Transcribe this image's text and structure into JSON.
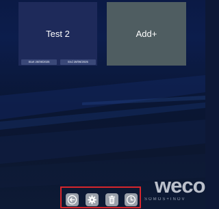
{
  "cards": {
    "test": {
      "title": "Test 2",
      "start_label": "Start 25/06/2025",
      "end_label": "End 28/06/2025"
    },
    "add": {
      "title": "Add+"
    }
  },
  "toolbar": {
    "buttons": [
      {
        "icon": "back-arrow-icon"
      },
      {
        "icon": "gear-icon"
      },
      {
        "icon": "trash-icon"
      },
      {
        "icon": "clock-icon"
      }
    ],
    "highlight_color": "#d8262c"
  },
  "brand": {
    "logo_text": "weco",
    "tagline": "SOMOS+INOV"
  },
  "colors": {
    "background": "#0d1836",
    "card_test": "#1e2a5a",
    "card_add": "#4f5d61",
    "button": "#9aa0aa"
  }
}
